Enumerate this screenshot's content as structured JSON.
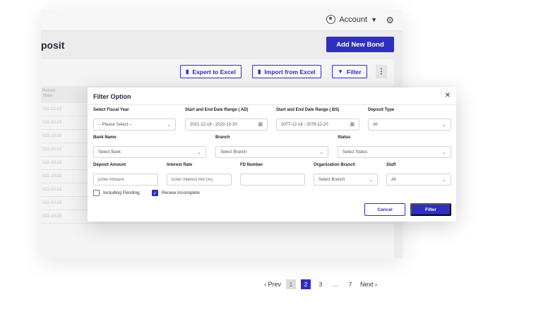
{
  "header": {
    "account_label": "Account",
    "page_title": "posit",
    "add_bond_label": "Add New Bond"
  },
  "toolbar": {
    "export_label": "Expert to Excel",
    "import_label": "Import from Excel",
    "filter_label": "Filter"
  },
  "table": {
    "header_text": "Return\nState",
    "rows": [
      "022-12-23",
      "022-10-23",
      "022-10-23",
      "022-10-23",
      "022-10-23",
      "022-10-23",
      "022-10-23",
      "022-10-23",
      "022-10-23"
    ]
  },
  "pagination": {
    "prev": "Prev",
    "pages": [
      "1",
      "2",
      "3",
      "...",
      "7"
    ],
    "next": "Next",
    "active": "2"
  },
  "modal": {
    "title": "Filter Option",
    "fiscal_year": {
      "label": "Select Fiscal Year",
      "value": "-- Please Select --"
    },
    "ad_range": {
      "label": "Start and End Date Range ( AD)",
      "value": "2021-12-18  -  2022-12-20"
    },
    "bs_range": {
      "label": "Start and End Date Range ( BS)",
      "value": "2077-12-18  -  2079-12-20"
    },
    "deposit_type": {
      "label": "Deposit Type",
      "value": "All"
    },
    "bank_name": {
      "label": "Bank Name",
      "value": "Select Bank"
    },
    "branch": {
      "label": "Branch",
      "value": "Select Branch"
    },
    "status": {
      "label": "Status",
      "value": "Select Status"
    },
    "deposit_amount": {
      "label": "Deposit Amount",
      "placeholder": "Enter Amount"
    },
    "interest_rate": {
      "label": "Interest Rate",
      "placeholder": "Enter Interest Rte (%)"
    },
    "fd_number": {
      "label": "FD Number",
      "placeholder": ""
    },
    "org_branch": {
      "label": "Organization Branch",
      "value": "Select Branch"
    },
    "staff": {
      "label": "Staff",
      "value": "All"
    },
    "including_pending_label": "Including Pending",
    "renew_incomplete_label": "Renew Incomplete",
    "cancel_label": "Cancel",
    "filter_label": "Filter"
  },
  "colors": {
    "accent": "#2f2fbf"
  }
}
